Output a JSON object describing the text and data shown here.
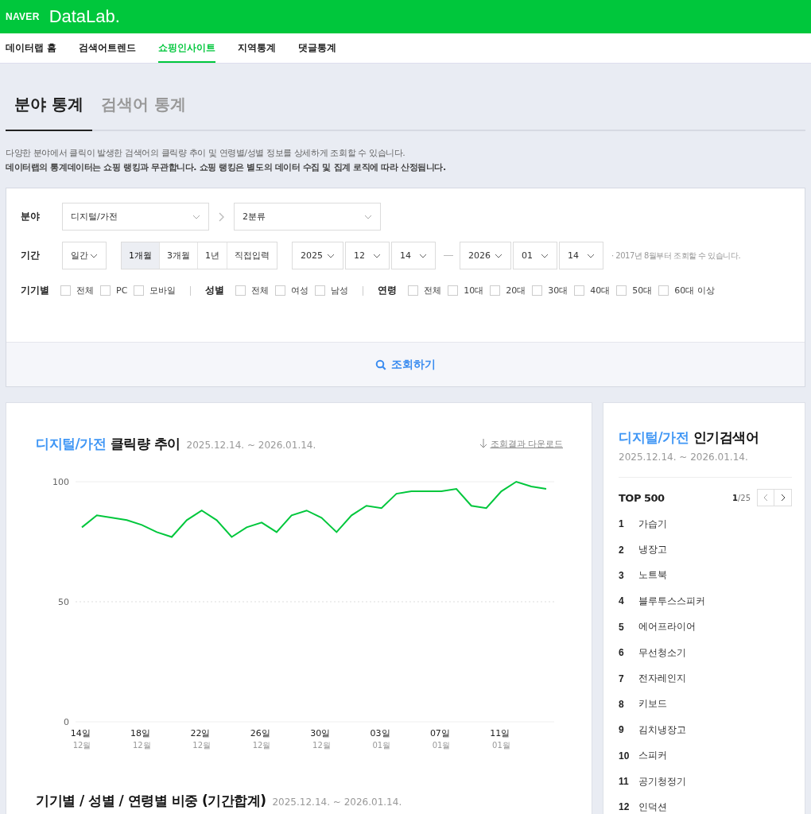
{
  "brand": {
    "naver": "NAVER",
    "product": "DataLab."
  },
  "nav": [
    {
      "label": "데이터랩 홈",
      "selected": false
    },
    {
      "label": "검색어트렌드",
      "selected": false
    },
    {
      "label": "쇼핑인사이트",
      "selected": true
    },
    {
      "label": "지역통계",
      "selected": false
    },
    {
      "label": "댓글통계",
      "selected": false
    }
  ],
  "subtabs": [
    {
      "label": "분야 통계",
      "selected": true
    },
    {
      "label": "검색어 통계",
      "selected": false
    }
  ],
  "notice": [
    "다양한 분야에서 클릭이 발생한 검색어의 클릭량 추이 및 연령별/성별 정보를 상세하게 조회할 수 있습니다.",
    "데이터랩의 통계데이터는 쇼핑 랭킹과 무관합니다. 쇼핑 랭킹은 별도의 데이터 수집 및 집계 로직에 따라 산정됩니다."
  ],
  "filter": {
    "category_label": "분야",
    "category": [
      "디지털/가전",
      "2분류"
    ],
    "period_label": "기간",
    "unit": "일간",
    "ranges": [
      {
        "label": "1개월",
        "selected": true
      },
      {
        "label": "3개월",
        "selected": false
      },
      {
        "label": "1년",
        "selected": false
      },
      {
        "label": "직접입력",
        "selected": false
      }
    ],
    "start": [
      "2025",
      "12",
      "14"
    ],
    "end": [
      "2026",
      "01",
      "14"
    ],
    "period_note": "· 2017년 8월부터 조회할 수 있습니다.",
    "groups": [
      {
        "label": "기기별",
        "options": [
          {
            "label": "전체",
            "checked": false
          },
          {
            "label": "PC",
            "checked": false
          },
          {
            "label": "모바일",
            "checked": false
          }
        ]
      },
      {
        "label": "성별",
        "options": [
          {
            "label": "전체",
            "checked": false
          },
          {
            "label": "여성",
            "checked": false
          },
          {
            "label": "남성",
            "checked": false
          }
        ]
      },
      {
        "label": "연령",
        "options": [
          {
            "label": "전체",
            "checked": false
          },
          {
            "label": "10대",
            "checked": false
          },
          {
            "label": "20대",
            "checked": false
          },
          {
            "label": "30대",
            "checked": false
          },
          {
            "label": "40대",
            "checked": false
          },
          {
            "label": "50대",
            "checked": false
          },
          {
            "label": "60대 이상",
            "checked": false
          }
        ]
      }
    ],
    "search_button": "조회하기"
  },
  "trend": {
    "category": "디지털/가전",
    "title": "클릭량 추이",
    "range": "2025.12.14. ~ 2026.01.14.",
    "download": "조회결과 다운로드",
    "chart_data": {
      "type": "line",
      "categories": [
        "14일 12월",
        null,
        null,
        null,
        "18일 12월",
        null,
        null,
        null,
        "22일 12월",
        null,
        null,
        null,
        "26일 12월",
        null,
        null,
        null,
        "30일 12월",
        null,
        null,
        null,
        "03일 01월",
        null,
        null,
        null,
        "07일 01월",
        null,
        null,
        null,
        "11일 01월",
        null,
        null,
        null
      ],
      "series": [
        {
          "color": "#00c73c",
          "values": [
            81,
            86,
            85,
            84,
            82,
            79,
            77,
            84,
            88,
            84,
            77,
            81,
            83,
            79,
            86,
            88,
            85,
            79,
            86,
            90,
            89,
            95,
            96,
            96,
            96,
            97,
            90,
            89,
            96,
            100,
            98,
            97
          ]
        }
      ],
      "ylim": [
        0,
        100
      ],
      "yticks": [
        0,
        50,
        100
      ]
    },
    "next_title": "기기별 / 성별 / 연령별 비중 (기간합계)",
    "next_range": "2025.12.14. ~ 2026.01.14."
  },
  "popular": {
    "category": "디지털/가전",
    "title": "인기검색어",
    "range": "2025.12.14. ~ 2026.01.14.",
    "top": "TOP 500",
    "page": "1",
    "pages": "/25",
    "items": [
      {
        "rank": "1",
        "term": "가습기"
      },
      {
        "rank": "2",
        "term": "냉장고"
      },
      {
        "rank": "3",
        "term": "노트북"
      },
      {
        "rank": "4",
        "term": "블루투스스피커"
      },
      {
        "rank": "5",
        "term": "에어프라이어"
      },
      {
        "rank": "6",
        "term": "무선청소기"
      },
      {
        "rank": "7",
        "term": "전자레인지"
      },
      {
        "rank": "8",
        "term": "키보드"
      },
      {
        "rank": "9",
        "term": "김치냉장고"
      },
      {
        "rank": "10",
        "term": "스피커"
      },
      {
        "rank": "11",
        "term": "공기청정기"
      },
      {
        "rank": "12",
        "term": "인덕션"
      }
    ]
  }
}
